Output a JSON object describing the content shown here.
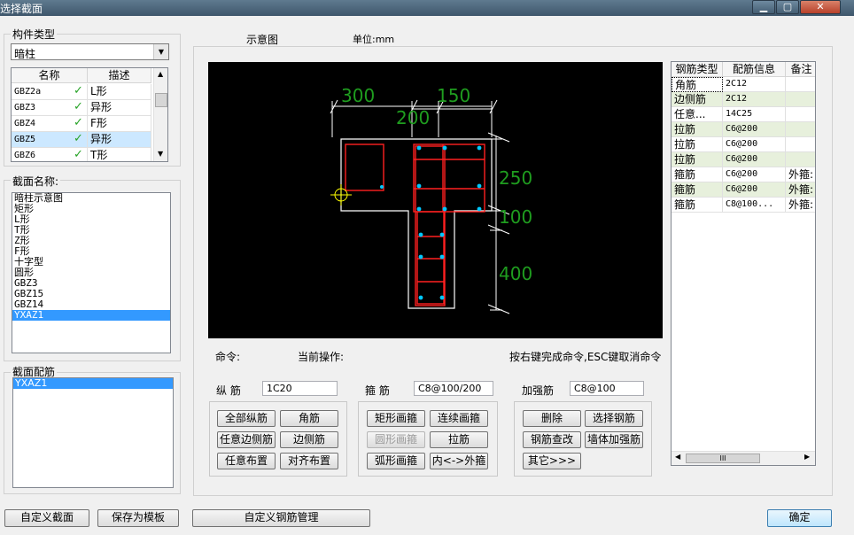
{
  "window": {
    "title": "选择截面",
    "min_icon": "minimize-icon",
    "max_icon": "maximize-icon",
    "close_icon": "close-icon"
  },
  "component_type": {
    "label": "构件类型",
    "selected": "暗柱"
  },
  "component_table": {
    "headers": [
      "名称",
      "描述"
    ],
    "rows": [
      {
        "name": "GBZ2a",
        "desc": "L形",
        "selected": false
      },
      {
        "name": "GBZ3",
        "desc": "异形",
        "selected": false
      },
      {
        "name": "GBZ4",
        "desc": "F形",
        "selected": false
      },
      {
        "name": "GBZ5",
        "desc": "异形",
        "selected": true
      },
      {
        "name": "GBZ6",
        "desc": "T形",
        "selected": false
      }
    ]
  },
  "section_name": {
    "label": "截面名称:",
    "items": [
      "暗柱示意图",
      "矩形",
      "L形",
      "T形",
      "Z形",
      "F形",
      "十字型",
      "圆形",
      "GBZ3",
      "GBZ15",
      "GBZ14",
      "YXAZ1"
    ],
    "selected_index": 11
  },
  "section_rebar": {
    "label": "截面配筋",
    "items": [
      "YXAZ1"
    ]
  },
  "diagram": {
    "label": "示意图",
    "unit_label": "单位:mm",
    "dims": {
      "top1": "300",
      "top2": "150",
      "top3": "200",
      "right1": "250",
      "right2": "100",
      "right3": "400"
    }
  },
  "command": {
    "label": "命令:",
    "current_op": "当前操作:",
    "hint": "按右键完成命令,ESC键取消命令"
  },
  "long_rebar": {
    "label": "纵 筋",
    "value": "1C20",
    "buttons": [
      "全部纵筋",
      "角筋",
      "任意边侧筋",
      "边侧筋",
      "任意布置",
      "对齐布置"
    ]
  },
  "stirrup": {
    "label": "箍 筋",
    "value": "C8@100/200",
    "buttons": [
      "矩形画箍",
      "连续画箍",
      "圆形画箍",
      "拉筋",
      "弧形画箍",
      "内<->外箍"
    ]
  },
  "strengthen": {
    "label": "加强筋",
    "value": "C8@100",
    "buttons": [
      "删除",
      "选择钢筋",
      "钢筋查改",
      "墙体加强筋",
      "其它>>>"
    ]
  },
  "rebar_table": {
    "headers": [
      "钢筋类型",
      "配筋信息",
      "备注"
    ],
    "rows": [
      {
        "type": "角筋",
        "info": "2C12",
        "note": ""
      },
      {
        "type": "边侧筋",
        "info": "2C12",
        "note": ""
      },
      {
        "type": "任意...",
        "info": "14C25",
        "note": ""
      },
      {
        "type": "拉筋",
        "info": "C6@200",
        "note": ""
      },
      {
        "type": "拉筋",
        "info": "C6@200",
        "note": ""
      },
      {
        "type": "拉筋",
        "info": "C6@200",
        "note": ""
      },
      {
        "type": "箍筋",
        "info": "C6@200",
        "note": "外箍:"
      },
      {
        "type": "箍筋",
        "info": "C6@200",
        "note": "外箍:"
      },
      {
        "type": "箍筋",
        "info": "C8@100...",
        "note": "外箍:"
      }
    ],
    "hscroll_thumb": "III"
  },
  "bottom": {
    "custom_section": "自定义截面",
    "save_template": "保存为模板",
    "custom_rebar_mgmt": "自定义钢筋管理",
    "ok": "确定"
  },
  "colors": {
    "canvas_bg": "#000000",
    "dim_text": "#1f9d1f",
    "outline": "#ffffff",
    "rebar": "#ff2020",
    "bar_dot": "#00c8ff",
    "selection": "#3399ff",
    "row_tint": "#e7f0dc"
  }
}
